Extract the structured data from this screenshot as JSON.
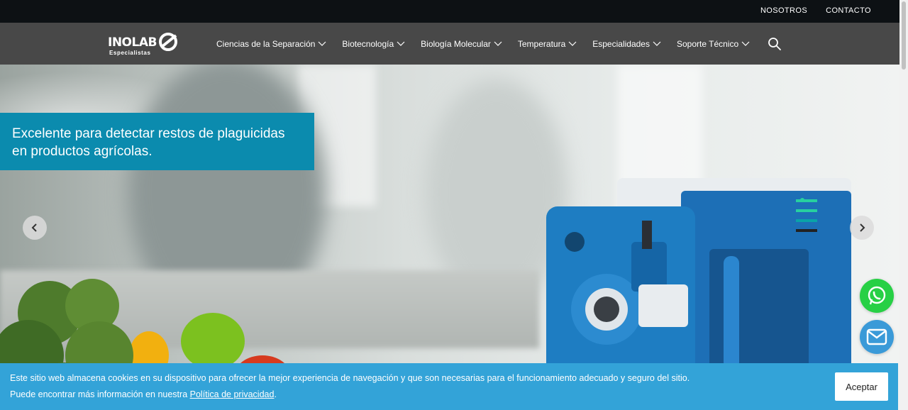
{
  "topbar": {
    "links": [
      "NOSOTROS",
      "CONTACTO"
    ]
  },
  "brand": {
    "name": "INOLAB",
    "tagline": "Especialistas"
  },
  "nav": {
    "items": [
      "Ciencias de la Separación",
      "Biotecnología",
      "Biología Molecular",
      "Temperatura",
      "Especialidades",
      "Soporte Técnico"
    ],
    "search_icon": "search-icon"
  },
  "hero": {
    "caption_line1": "Excelente para detectar restos de plaguicidas",
    "caption_line2": "en productos agrícolas.",
    "prev_icon": "chevron-left-icon",
    "next_icon": "chevron-right-icon"
  },
  "floating": {
    "whatsapp_icon": "whatsapp-icon",
    "mail_icon": "mail-icon"
  },
  "cookie": {
    "line1": "Este sitio web almacena cookies en su dispositivo para ofrecer la mejor experiencia de navegación y que son necesarias para el funcionamiento adecuado y seguro del sitio.",
    "line2_prefix": "Puede encontrar más información en nuestra ",
    "policy_link": "Política de privacidad",
    "line2_suffix": ".",
    "accept": "Aceptar"
  },
  "colors": {
    "caption_bg": "#0b8bae",
    "cookie_bg": "#33a3d8",
    "whatsapp": "#27d045",
    "mail": "#3a9ad8"
  }
}
